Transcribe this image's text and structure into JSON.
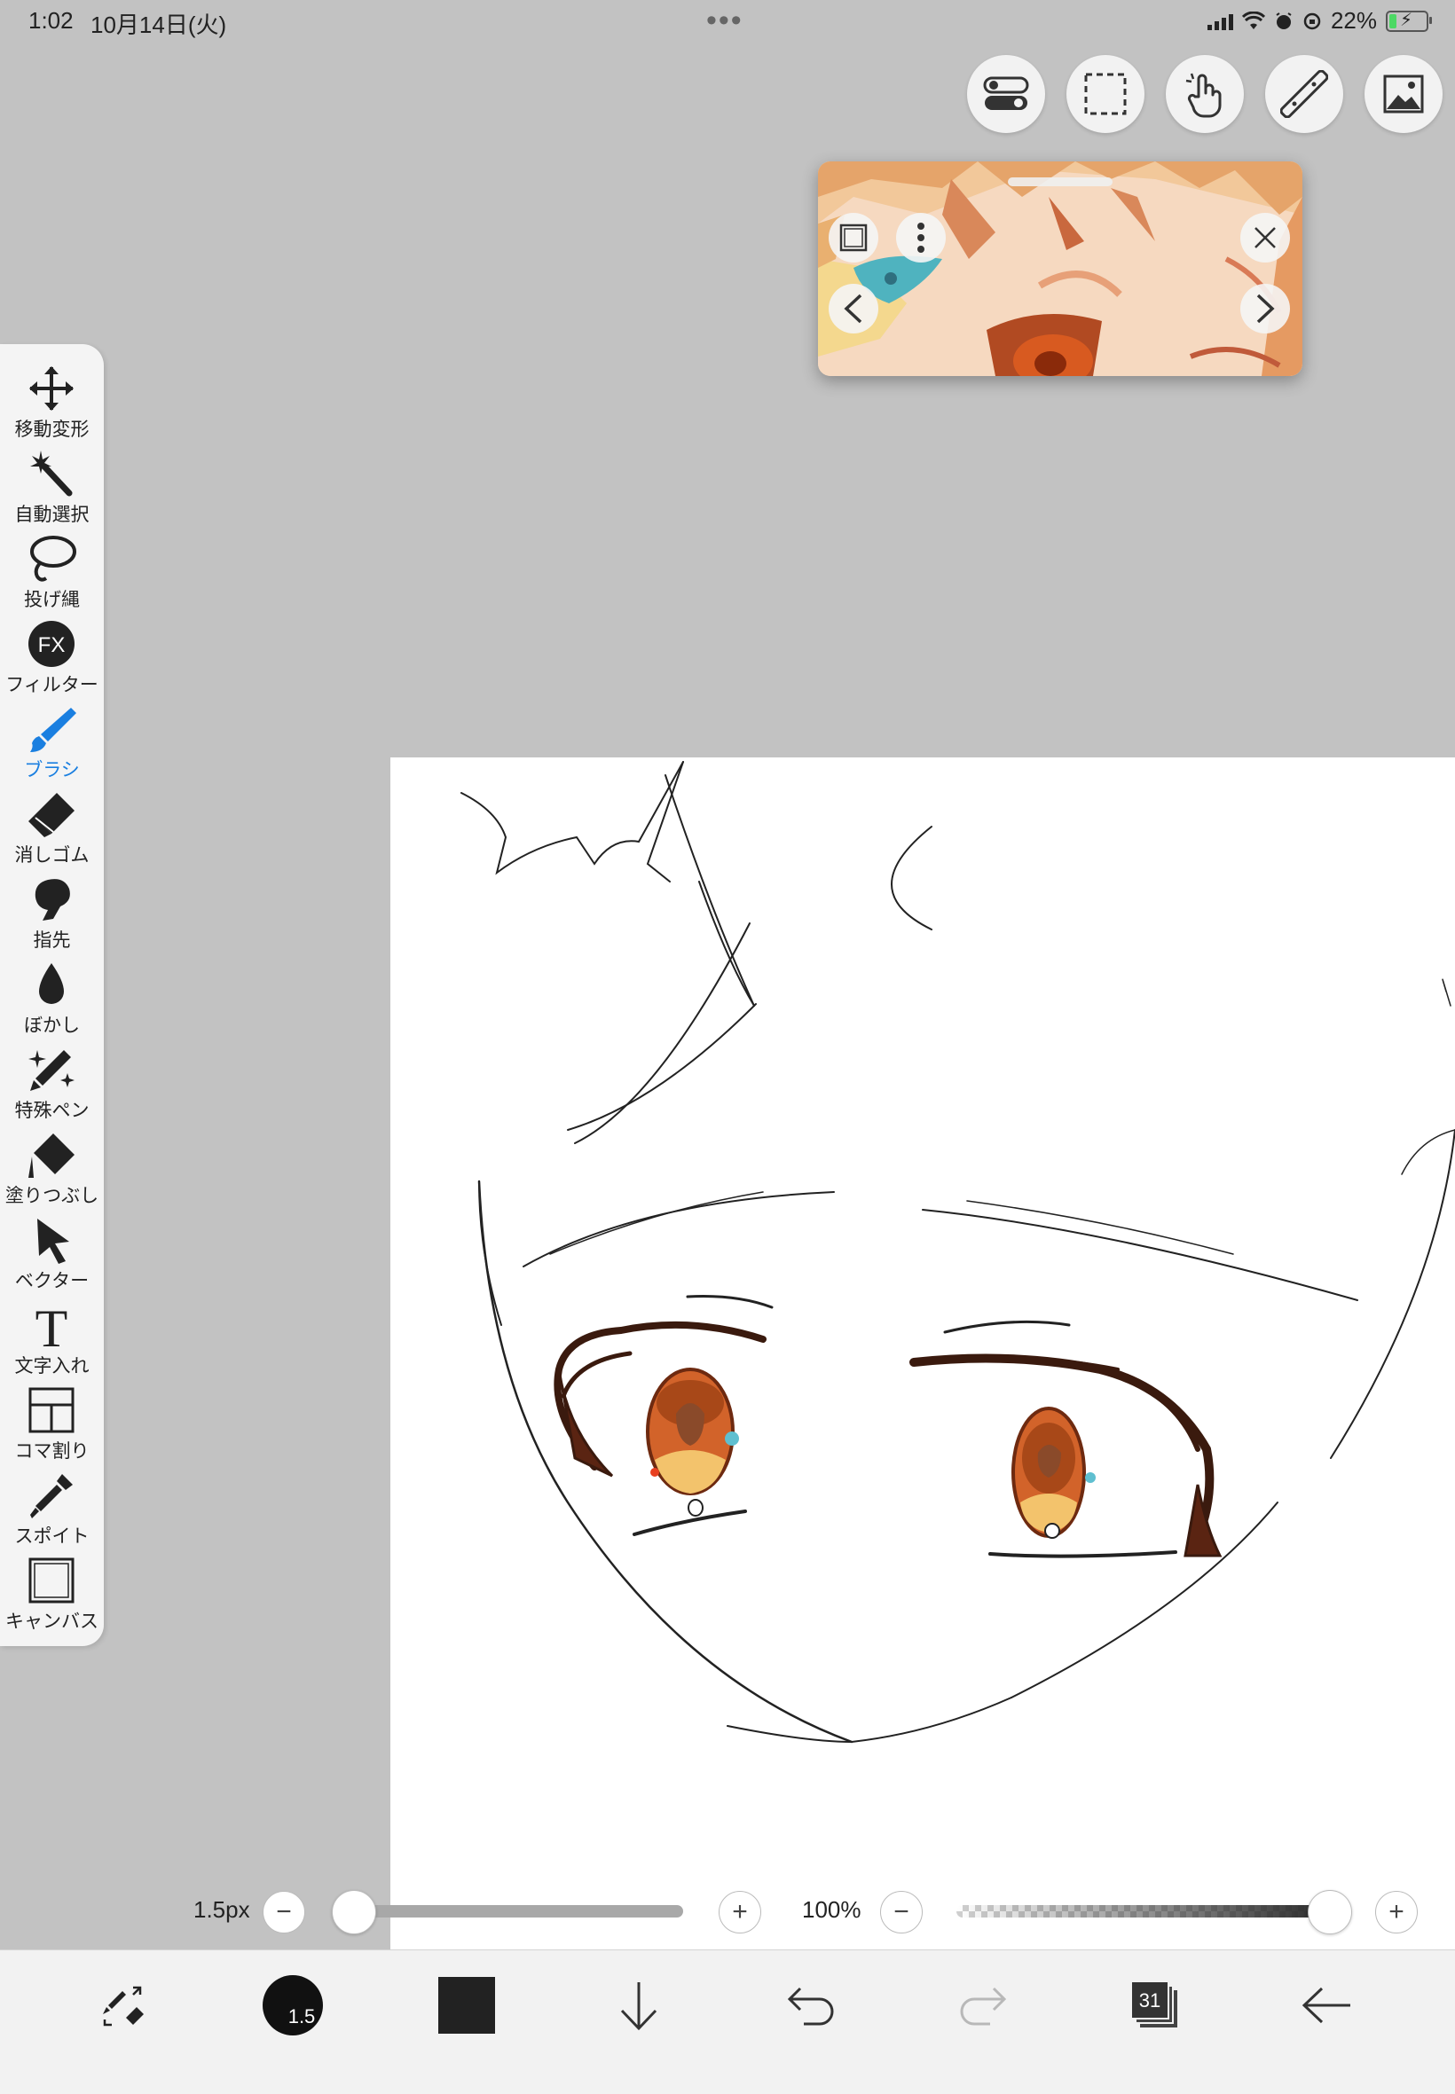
{
  "status_bar": {
    "time": "1:02",
    "date": "10月14日(火)",
    "battery": "22%",
    "battery_level": 0.22
  },
  "top_buttons": [
    "toggle-icon",
    "selection-icon",
    "touch-icon",
    "ruler-icon",
    "image-icon"
  ],
  "reference_window": {
    "buttons": [
      "square-icon",
      "more-icon",
      "close-icon",
      "prev-icon",
      "next-icon"
    ]
  },
  "toolbar": {
    "tools": [
      {
        "id": "move",
        "label": "移動変形",
        "icon": "move-icon"
      },
      {
        "id": "magic",
        "label": "自動選択",
        "icon": "magic-wand-icon"
      },
      {
        "id": "lasso",
        "label": "投げ縄",
        "icon": "lasso-icon"
      },
      {
        "id": "filter",
        "label": "フィルター",
        "icon": "fx-icon",
        "icon_text": "FX"
      },
      {
        "id": "brush",
        "label": "ブラシ",
        "icon": "brush-icon",
        "active": true
      },
      {
        "id": "eraser",
        "label": "消しゴム",
        "icon": "eraser-icon"
      },
      {
        "id": "smudge",
        "label": "指先",
        "icon": "finger-icon"
      },
      {
        "id": "blur",
        "label": "ぼかし",
        "icon": "drop-icon"
      },
      {
        "id": "special",
        "label": "特殊ペン",
        "icon": "sparkle-pen-icon"
      },
      {
        "id": "fill",
        "label": "塗りつぶし",
        "icon": "bucket-icon"
      },
      {
        "id": "vector",
        "label": "ベクター",
        "icon": "vector-arrow-icon"
      },
      {
        "id": "text",
        "label": "文字入れ",
        "icon": "text-icon",
        "icon_text": "T"
      },
      {
        "id": "frame",
        "label": "コマ割り",
        "icon": "frame-divider-icon"
      },
      {
        "id": "eyedropper",
        "label": "スポイト",
        "icon": "eyedropper-icon"
      },
      {
        "id": "canvas",
        "label": "キャンバス",
        "icon": "canvas-icon"
      }
    ]
  },
  "brush_size": {
    "label": "1.5px",
    "minus": "−",
    "plus": "+",
    "value_fraction": 0.0
  },
  "opacity": {
    "label": "100%",
    "minus": "−",
    "plus": "+",
    "value_fraction": 1.0
  },
  "bottom_bar": {
    "brush_preview_label": "1.5",
    "layer_count": "31",
    "current_color": "#222222",
    "icons": [
      "swap-tool-icon",
      "brush-size-icon",
      "color-swatch-icon",
      "import-down-icon",
      "undo-icon",
      "redo-icon",
      "layers-icon",
      "back-icon"
    ]
  },
  "colors": {
    "accent": "#1a7fe0",
    "canvas_bg": "#ffffff",
    "app_bg": "#c2c2c2"
  }
}
